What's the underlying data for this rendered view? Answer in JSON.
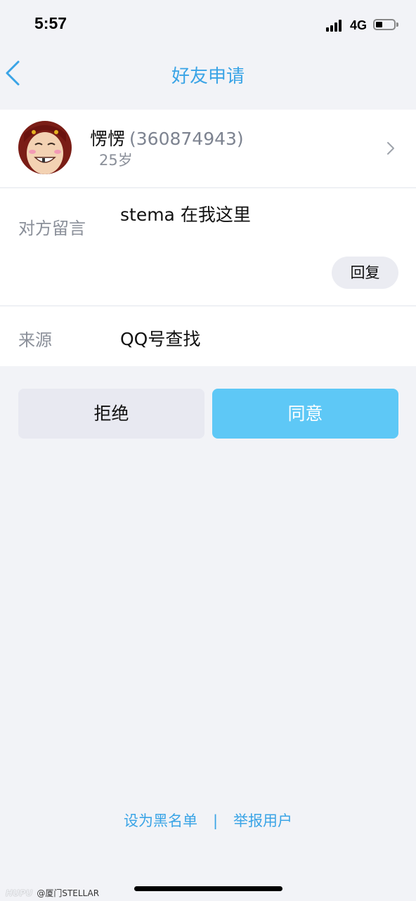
{
  "status_bar": {
    "time": "5:57",
    "network": "4G"
  },
  "nav": {
    "title": "好友申请",
    "back_icon": "chevron-left-icon"
  },
  "profile": {
    "nickname": "愣愣",
    "qq_number": "(360874943)",
    "age": "25岁",
    "chevron_icon": "chevron-right-icon"
  },
  "message": {
    "label": "对方留言",
    "text": "stema 在我这里",
    "reply_label": "回复"
  },
  "source": {
    "label": "来源",
    "value": "QQ号查找"
  },
  "actions": {
    "reject_label": "拒绝",
    "agree_label": "同意"
  },
  "footer": {
    "blacklist_label": "设为黑名单",
    "separator": "|",
    "report_label": "举报用户"
  },
  "watermark": {
    "brand": "HUPU",
    "text": "@厦门STELLAR"
  },
  "colors": {
    "accent": "#3aa4e6",
    "agree_button": "#5ec8f6",
    "reject_button": "#e8e9f1",
    "background": "#f2f3f7"
  }
}
